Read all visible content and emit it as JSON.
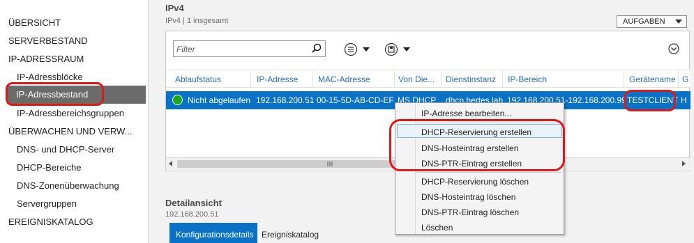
{
  "sidebar": {
    "items": [
      {
        "label": "ÜBERSICHT"
      },
      {
        "label": "SERVERBESTAND"
      },
      {
        "label": "IP-ADRESSRAUM"
      },
      {
        "label": "IP-Adressblöcke"
      },
      {
        "label": "IP-Adressbestand"
      },
      {
        "label": "IP-Adressbereichsgruppen"
      },
      {
        "label": "ÜBERWACHEN UND VERW..."
      },
      {
        "label": "DNS- und DHCP-Server"
      },
      {
        "label": "DHCP-Bereiche"
      },
      {
        "label": "DNS-Zonenüberwachung"
      },
      {
        "label": "Servergruppen"
      },
      {
        "label": "EREIGNISKATALOG"
      }
    ],
    "selected_index": 4
  },
  "main": {
    "title": "IPv4",
    "subtitle": "IPv4 | 1 insgesamt",
    "tasks_button": "AUFGABEN",
    "filter_placeholder": "Filter",
    "columns": [
      "Ablaufstatus",
      "IP-Adresse",
      "MAC-Adresse",
      "Von Die...",
      "Dienstinstanz",
      "IP-Bereich",
      "Gerätename",
      "G"
    ],
    "row": {
      "status": "Nicht abgelaufen",
      "ip": "192.168.200.51",
      "mac": "00-15-5D-AB-CD-EF",
      "source": "MS DHCP",
      "instance": "dhcp.hertes.lab",
      "range": "192.168.200.51-192.168.200.99",
      "device": "TESTCLIENT",
      "extra": "H"
    }
  },
  "details": {
    "title": "Detailansicht",
    "subtitle": "192.168.200.51",
    "tabs": [
      "Konfigurationsdetails",
      "Ereigniskatalog"
    ]
  },
  "context_menu": {
    "items": [
      "IP-Adresse bearbeiten...",
      "DHCP-Reservierung erstellen",
      "DNS-Hosteintrag erstellen",
      "DNS-PTR-Eintrag erstellen",
      "DHCP-Reservierung löschen",
      "DNS-Hosteintrag löschen",
      "DNS-PTR-Eintrag löschen",
      "Löschen"
    ]
  },
  "colors": {
    "selection_blue": "#0a72c6",
    "header_text": "#2a6db5",
    "annotation_red": "#e01818",
    "status_green": "#1ea71e"
  }
}
